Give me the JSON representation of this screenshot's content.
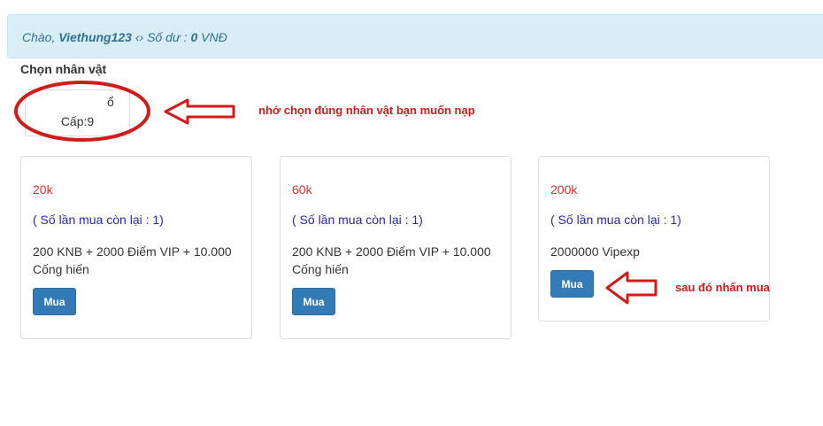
{
  "header": {
    "greeting": "Chào,",
    "username": "Viethung123",
    "separator": "‹› Số dư :",
    "balance": "0",
    "currency": "VNĐ"
  },
  "character": {
    "section_label": "Chọn nhân vật",
    "name": "ổ",
    "level": "Cấp:9"
  },
  "annotations": {
    "select_note": "nhớ chọn đúng nhân vật bạn muốn nạp",
    "buy_note": "sau đó nhấn mua",
    "accent_color": "#d11a1a"
  },
  "packages": [
    {
      "price": "20k",
      "remaining": "( Số lần mua còn lại : 1)",
      "description": "200 KNB + 2000 Điểm VIP + 10.000 Cống hiến",
      "button": "Mua"
    },
    {
      "price": "60k",
      "remaining": "( Số lần mua còn lại : 1)",
      "description": "200 KNB + 2000 Điểm VIP + 10.000 Cống hiến",
      "button": "Mua"
    },
    {
      "price": "200k",
      "remaining": "( Số lần mua còn lại : 1)",
      "description": "2000000 Vipexp",
      "button": "Mua"
    }
  ],
  "colors": {
    "alert_bg": "#d9edf7",
    "alert_text": "#31708f",
    "price": "#d9302c",
    "remaining": "#2426b4",
    "button": "#337ab7"
  }
}
